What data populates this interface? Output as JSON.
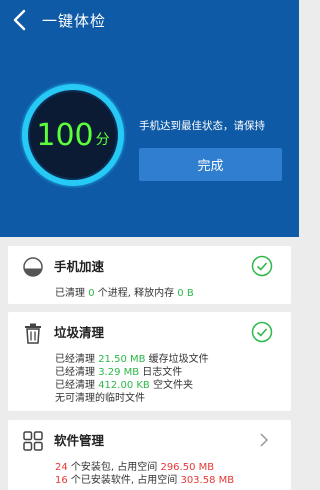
{
  "header": {
    "title": "一键体检",
    "score": "100",
    "score_unit": "分",
    "status": "手机达到最佳状态，请保持",
    "done_label": "完成"
  },
  "cards": {
    "speedup": {
      "title": "手机加速",
      "line1": {
        "prefix": "已清理 ",
        "value": "0",
        "middle": " 个进程, 释放内存 ",
        "value2": "0 B"
      }
    },
    "junk": {
      "title": "垃圾清理",
      "line1": {
        "prefix": "已经清理 ",
        "value": "21.50 MB",
        "suffix": " 缓存垃圾文件"
      },
      "line2": {
        "prefix": "已经清理 ",
        "value": "3.29 MB",
        "suffix": " 日志文件"
      },
      "line3": {
        "prefix": "已经清理 ",
        "value": "412.00 KB",
        "suffix": " 空文件夹"
      },
      "line4": "无可清理的临时文件"
    },
    "software": {
      "title": "软件管理",
      "line1": {
        "value": "24",
        "middle": " 个安装包, 占用空间 ",
        "value2": "296.50 MB"
      },
      "line2": {
        "value": "16",
        "middle": " 个已安装软件, 占用空间 ",
        "value2": "303.58 MB"
      }
    }
  },
  "colors": {
    "header_bg": "#0e5aa6",
    "accent_green": "#2eb84a",
    "accent_red": "#e53935",
    "button_bg": "#2f7ed0"
  }
}
